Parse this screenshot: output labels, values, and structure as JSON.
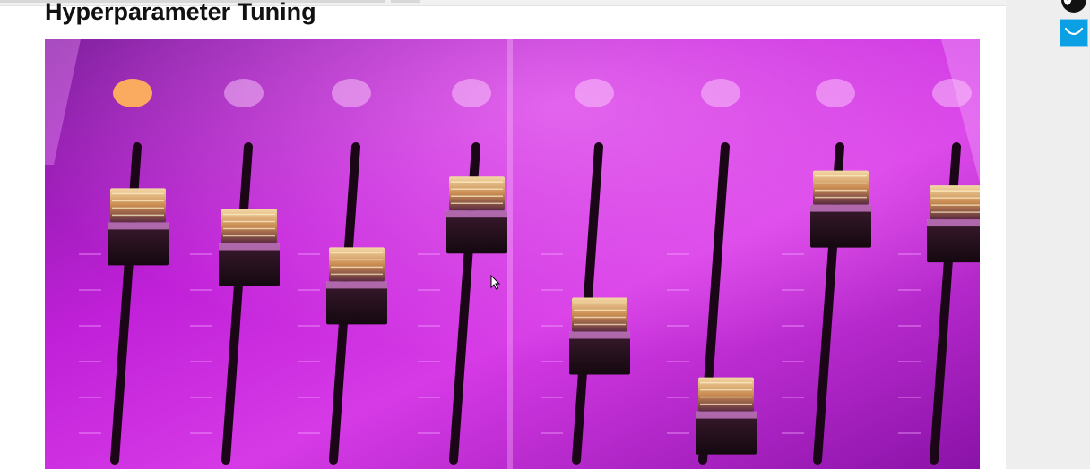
{
  "article": {
    "title": "Hyperparameter Tuning",
    "image": {
      "subject": "mixing-console-faders",
      "tint": "#c21fd6",
      "faders": [
        {
          "level": 0.92
        },
        {
          "level": 0.85
        },
        {
          "level": 0.72
        },
        {
          "level": 0.96
        },
        {
          "level": 0.55
        },
        {
          "level": 0.28
        },
        {
          "level": 0.98
        },
        {
          "level": 0.93
        }
      ]
    }
  },
  "sidebar": {
    "logo_icon": "tulip-logo-icon",
    "button_icon": "smile-icon",
    "button_color": "#0b9fe3"
  }
}
